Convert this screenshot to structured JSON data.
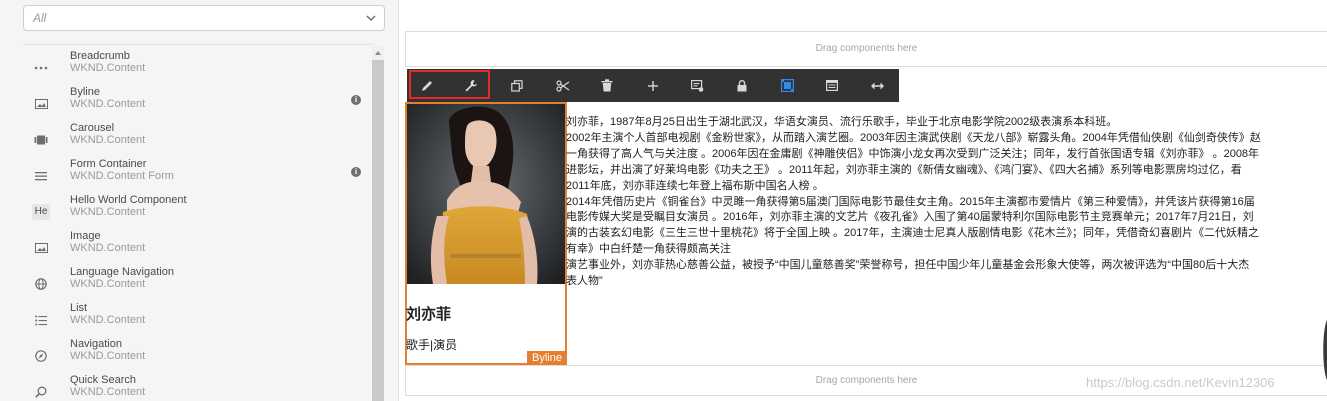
{
  "filter": {
    "value": "All"
  },
  "components": [
    {
      "name": "Breadcrumb",
      "group": "WKND.Content",
      "icon": "more-horizontal-icon",
      "info": false
    },
    {
      "name": "Byline",
      "group": "WKND.Content",
      "icon": "image-icon",
      "info": true
    },
    {
      "name": "Carousel",
      "group": "WKND.Content",
      "icon": "carousel-icon",
      "info": false
    },
    {
      "name": "Form Container",
      "group": "WKND.Content Form",
      "icon": "list-lines-icon",
      "info": true
    },
    {
      "name": "Hello World Component",
      "group": "WKND.Content",
      "icon": "abbrev-he-icon",
      "info": false,
      "abbr": "He"
    },
    {
      "name": "Image",
      "group": "WKND.Content",
      "icon": "image-icon",
      "info": false
    },
    {
      "name": "Language Navigation",
      "group": "WKND.Content",
      "icon": "globe-icon",
      "info": false
    },
    {
      "name": "List",
      "group": "WKND.Content",
      "icon": "bulleted-list-icon",
      "info": false
    },
    {
      "name": "Navigation",
      "group": "WKND.Content",
      "icon": "compass-icon",
      "info": false
    },
    {
      "name": "Quick Search",
      "group": "WKND.Content",
      "icon": "search-icon",
      "info": false
    }
  ],
  "dropzones": {
    "top": "Drag components here",
    "bottom": "Drag components here"
  },
  "toolbar": {
    "buttons": [
      "pencil-icon",
      "wrench-icon",
      "copy-icon",
      "cut-icon",
      "delete-icon",
      "add-icon",
      "group-icon",
      "lock-icon",
      "layout-icon",
      "panel-icon",
      "resize-icon"
    ],
    "active": "layout-icon",
    "highlight_color": "#e42b2b"
  },
  "byline": {
    "name": "刘亦菲",
    "occupation": "歌手|演员",
    "tag": "Byline",
    "accent": "#e47f2f"
  },
  "article": {
    "lines": [
      "刘亦菲，1987年8月25日出生于湖北武汉，华语女演员、流行乐歌手，毕业于北京电影学院2002级表演系本科班。",
      "2002年主演个人首部电视剧《金粉世家》，从而踏入演艺圈。2003年因主演武侠剧《天龙八部》崭露头角。2004年凭借仙侠剧《仙剑奇侠传》赵",
      "一角获得了高人气与关注度 。2006年因在金庸剧《神雕侠侣》中饰演小龙女再次受到广泛关注；同年，发行首张国语专辑《刘亦菲》 。2008年",
      "进影坛，并出演了好莱坞电影《功夫之王》 。2011年起，刘亦菲主演的《新倩女幽魂》、《鸿门宴》、《四大名捕》系列等电影票房均过亿，看",
      "2011年底，刘亦菲连续七年登上福布斯中国名人榜 。",
      "2014年凭借历史片《铜雀台》中灵雎一角获得第5届澳门国际电影节最佳女主角。2015年主演都市爱情片《第三种爱情》，并凭该片获得第16届",
      "电影传媒大奖是受瞩目女演员 。2016年，刘亦菲主演的文艺片《夜孔雀》入围了第40届蒙特利尔国际电影节主竞赛单元；2017年7月21日，刘",
      "演的古装玄幻电影《三生三世十里桃花》将于全国上映 。2017年，主演迪士尼真人版剧情电影《花木兰》；同年，凭借奇幻喜剧片《二代妖精之",
      "有幸》中白纤楚一角获得颇高关注",
      "演艺事业外，刘亦菲热心慈善公益，被授予“中国儿童慈善奖”荣誉称号，担任中国少年儿童基金会形象大使等，两次被评选为“中国80后十大杰",
      "表人物”"
    ]
  },
  "watermark": "https://blog.csdn.net/Kevin12306"
}
